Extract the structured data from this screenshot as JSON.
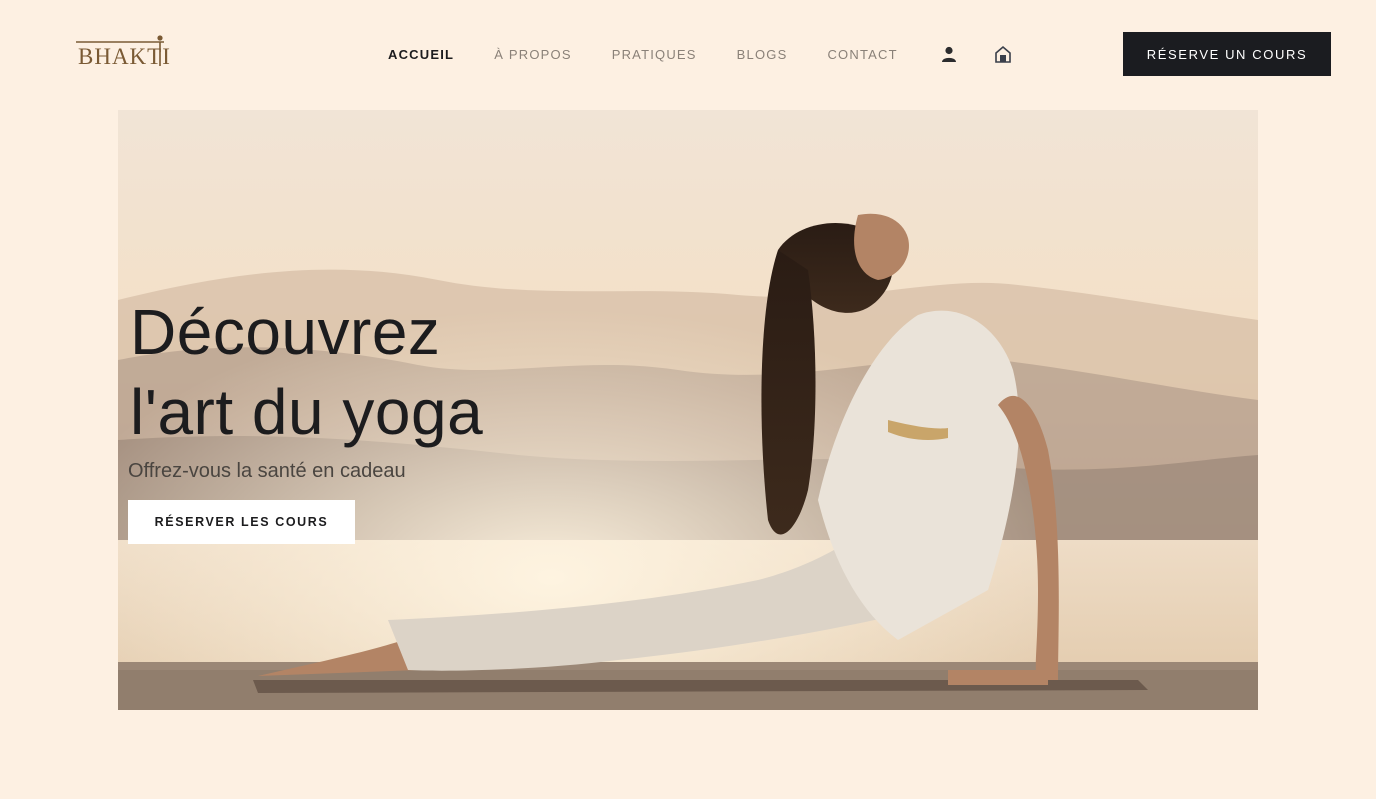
{
  "brand": {
    "name": "BHAKTI",
    "color": "#7a5a34"
  },
  "nav": {
    "items": [
      {
        "label": "ACCUEIL",
        "active": true
      },
      {
        "label": "À PROPOS",
        "active": false
      },
      {
        "label": "PRATIQUES",
        "active": false
      },
      {
        "label": "BLOGS",
        "active": false
      },
      {
        "label": "CONTACT",
        "active": false
      }
    ],
    "icons": [
      "user-icon",
      "home-icon"
    ]
  },
  "header": {
    "cta_label": "RÉSERVE UN COURS"
  },
  "hero": {
    "title_line1": "Découvrez",
    "title_line2": "l'art du yoga",
    "subtitle": "Offrez-vous la santé en cadeau",
    "button_label": "RÉSERVER LES COURS",
    "image": "woman-doing-cobra-yoga-pose-by-lake-at-sunrise"
  },
  "colors": {
    "page_bg": "#fdf0e2",
    "dark_button": "#1b1c20",
    "text_dark": "#1c1c1e",
    "nav_muted": "#8a8178"
  }
}
